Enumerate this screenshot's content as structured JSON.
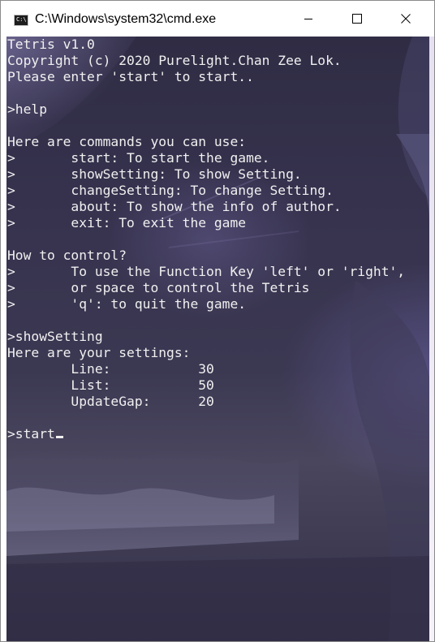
{
  "window": {
    "title": "C:\\Windows\\system32\\cmd.exe",
    "icon_name": "cmd-icon",
    "icon_text": "C:\\"
  },
  "controls": [
    "minimize-icon",
    "maximize-icon",
    "close-icon"
  ],
  "terminal": {
    "lines": [
      "Tetris v1.0",
      "Copyright (c) 2020 Purelight.Chan Zee Lok.",
      "Please enter 'start' to start..",
      "",
      ">help",
      "",
      "Here are commands you can use:",
      ">       start: To start the game.",
      ">       showSetting: To show Setting.",
      ">       changeSetting: To change Setting.",
      ">       about: To show the info of author.",
      ">       exit: To exit the game",
      "",
      "How to control?",
      ">       To use the Function Key 'left' or 'right',",
      ">       or space to control the Tetris",
      ">       'q': to quit the game.",
      "",
      ">showSetting",
      "Here are your settings:",
      "        Line:           30",
      "        List:           50",
      "        UpdateGap:      20",
      ""
    ],
    "prompt_input": ">start"
  },
  "colors": {
    "console_text": "#f0f0f0",
    "console_bg": "#35324b",
    "titlebar_bg": "#ffffff"
  }
}
